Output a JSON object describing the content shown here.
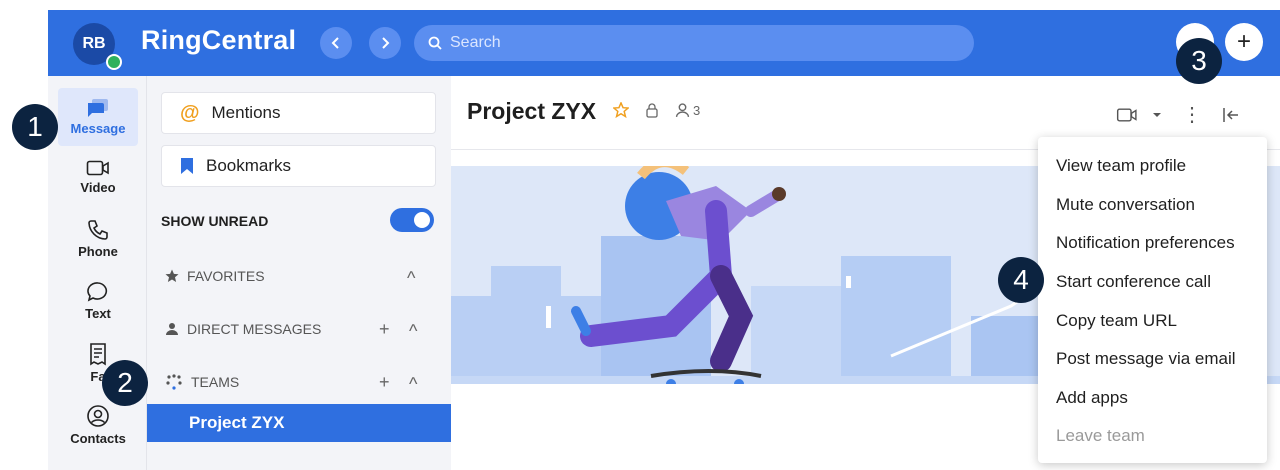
{
  "header": {
    "avatar_initials": "RB",
    "brand": "RingCentral",
    "back_icon": "chevron-left-icon",
    "forward_icon": "chevron-right-icon",
    "search_placeholder": "Search",
    "add_icon": "plus-icon",
    "add_glyph": "+",
    "accent_color": "#2f6fe0",
    "presence_color": "#2fb15c"
  },
  "rail": {
    "items": [
      {
        "label": "Message",
        "icon": "message-icon",
        "active": true
      },
      {
        "label": "Video",
        "icon": "video-icon"
      },
      {
        "label": "Phone",
        "icon": "phone-icon"
      },
      {
        "label": "Text",
        "icon": "text-bubble-icon"
      },
      {
        "label": "Fa",
        "icon": "fax-icon"
      },
      {
        "label": "Contacts",
        "icon": "contacts-icon"
      }
    ]
  },
  "panel": {
    "mentions": "Mentions",
    "bookmarks": "Bookmarks",
    "show_unread": "SHOW UNREAD",
    "show_unread_on": true,
    "sections": {
      "favorites": "FAVORITES",
      "direct_messages": "DIRECT MESSAGES",
      "teams": "TEAMS"
    },
    "add_glyph": "+",
    "collapse_glyph": "^",
    "selected_team": "Project ZYX"
  },
  "conversation": {
    "title": "Project ZYX",
    "member_count": "3",
    "more_glyph": "⋮"
  },
  "menu": {
    "items": [
      {
        "label": "View team profile"
      },
      {
        "label": "Mute conversation"
      },
      {
        "label": "Notification preferences"
      },
      {
        "label": "Start conference call"
      },
      {
        "label": "Copy team URL"
      },
      {
        "label": "Post message via email"
      },
      {
        "label": "Add apps"
      },
      {
        "label": "Leave team",
        "disabled": true
      }
    ]
  },
  "callouts": [
    "1",
    "2",
    "3",
    "4"
  ]
}
